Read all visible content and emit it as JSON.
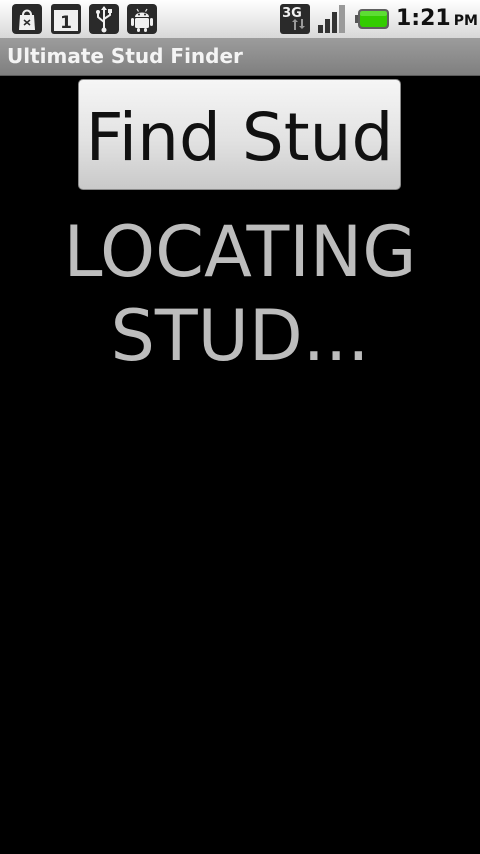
{
  "status_bar": {
    "icons_left": [
      "shopping-bag-icon",
      "calendar-icon",
      "usb-icon",
      "android-debug-icon"
    ],
    "calendar_day": "1",
    "network_label": "3G",
    "icons_right": [
      "network-3g-icon",
      "signal-bars-icon",
      "battery-icon"
    ],
    "time": "1:21",
    "ampm": "PM",
    "colors": {
      "battery": "#33cc00",
      "icon_dark": "#222222"
    }
  },
  "app": {
    "title": "Ultimate Stud Finder",
    "find_button_label": "Find Stud",
    "status_message": "LOCATING\nSTUD..."
  }
}
